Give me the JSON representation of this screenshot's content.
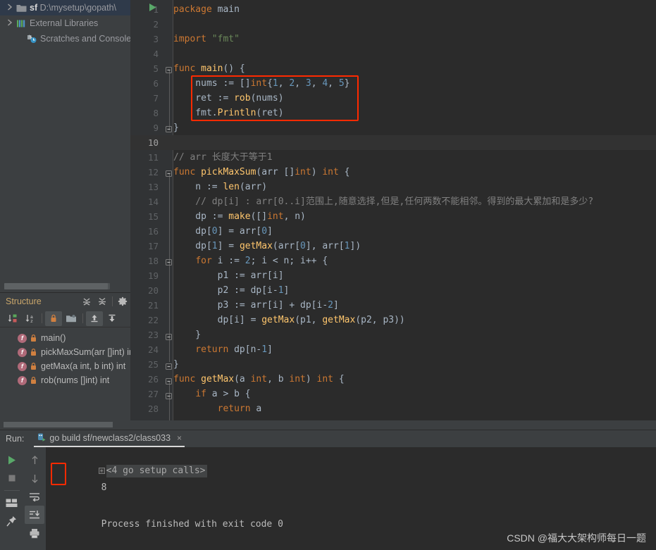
{
  "project": {
    "rows": [
      {
        "indent": 0,
        "twisty": "chevron-right-icon",
        "icon": "folder-icon",
        "name_bold": "sf",
        "name_dim": "D:\\mysetup\\gopath\\",
        "selected": true
      },
      {
        "indent": 0,
        "twisty": "chevron-right-icon",
        "icon": "library-icon",
        "name_bold": "",
        "name_dim": "External Libraries",
        "selected": false
      },
      {
        "indent": 1,
        "twisty": "",
        "icon": "scratches-icon",
        "name_bold": "",
        "name_dim": "Scratches and Consoles",
        "selected": false
      }
    ]
  },
  "structure": {
    "title": "Structure",
    "header_buttons": [
      "expand-all-icon",
      "collapse-all-icon",
      "settings-gear-icon"
    ],
    "toolbar_buttons": [
      "sort-by-visibility-icon",
      "sort-alphabetically-icon",
      "show-non-public-icon",
      "group-by-file-icon",
      "scroll-from-source-icon",
      "scroll-to-source-icon"
    ],
    "items": [
      {
        "kind": "f",
        "visibility": "lock-icon",
        "label": "main()"
      },
      {
        "kind": "f",
        "visibility": "lock-icon",
        "label": "pickMaxSum(arr []int) int"
      },
      {
        "kind": "f",
        "visibility": "lock-icon",
        "label": "getMax(a int, b int) int"
      },
      {
        "kind": "f",
        "visibility": "lock-icon",
        "label": "rob(nums []int) int"
      }
    ]
  },
  "editor": {
    "current_line": 10,
    "run_marker_line": 5,
    "lines": [
      {
        "n": 1,
        "tokens": [
          {
            "t": "kw",
            "v": "package"
          },
          {
            "t": "txt",
            "v": " main"
          }
        ]
      },
      {
        "n": 2,
        "tokens": []
      },
      {
        "n": 3,
        "tokens": [
          {
            "t": "kw",
            "v": "import"
          },
          {
            "t": "txt",
            "v": " "
          },
          {
            "t": "str",
            "v": "\"fmt\""
          }
        ]
      },
      {
        "n": 4,
        "tokens": []
      },
      {
        "n": 5,
        "tokens": [
          {
            "t": "kw",
            "v": "func"
          },
          {
            "t": "txt",
            "v": " "
          },
          {
            "t": "fn",
            "v": "main"
          },
          {
            "t": "txt",
            "v": "() {"
          }
        ]
      },
      {
        "n": 6,
        "tokens": [
          {
            "t": "txt",
            "v": "    nums := []"
          },
          {
            "t": "typ",
            "v": "int"
          },
          {
            "t": "txt",
            "v": "{"
          },
          {
            "t": "num",
            "v": "1"
          },
          {
            "t": "txt",
            "v": ", "
          },
          {
            "t": "num",
            "v": "2"
          },
          {
            "t": "txt",
            "v": ", "
          },
          {
            "t": "num",
            "v": "3"
          },
          {
            "t": "txt",
            "v": ", "
          },
          {
            "t": "num",
            "v": "4"
          },
          {
            "t": "txt",
            "v": ", "
          },
          {
            "t": "num",
            "v": "5"
          },
          {
            "t": "txt",
            "v": "}"
          }
        ]
      },
      {
        "n": 7,
        "tokens": [
          {
            "t": "txt",
            "v": "    ret := "
          },
          {
            "t": "fn",
            "v": "rob"
          },
          {
            "t": "txt",
            "v": "(nums)"
          }
        ]
      },
      {
        "n": 8,
        "tokens": [
          {
            "t": "txt",
            "v": "    fmt."
          },
          {
            "t": "fn",
            "v": "Println"
          },
          {
            "t": "txt",
            "v": "(ret)"
          }
        ]
      },
      {
        "n": 9,
        "tokens": [
          {
            "t": "txt",
            "v": "}"
          }
        ]
      },
      {
        "n": 10,
        "tokens": []
      },
      {
        "n": 11,
        "tokens": [
          {
            "t": "cmt",
            "v": "// arr 长度大于等于1"
          }
        ]
      },
      {
        "n": 12,
        "tokens": [
          {
            "t": "kw",
            "v": "func"
          },
          {
            "t": "txt",
            "v": " "
          },
          {
            "t": "fn",
            "v": "pickMaxSum"
          },
          {
            "t": "txt",
            "v": "(arr []"
          },
          {
            "t": "typ",
            "v": "int"
          },
          {
            "t": "txt",
            "v": ") "
          },
          {
            "t": "typ",
            "v": "int"
          },
          {
            "t": "txt",
            "v": " {"
          }
        ]
      },
      {
        "n": 13,
        "tokens": [
          {
            "t": "txt",
            "v": "    n := "
          },
          {
            "t": "fn",
            "v": "len"
          },
          {
            "t": "txt",
            "v": "(arr)"
          }
        ]
      },
      {
        "n": 14,
        "tokens": [
          {
            "t": "cmt",
            "v": "    // dp[i] : arr[0..i]范围上,随意选择,但是,任何两数不能相邻。得到的最大累加和是多少?"
          }
        ]
      },
      {
        "n": 15,
        "tokens": [
          {
            "t": "txt",
            "v": "    dp := "
          },
          {
            "t": "fn",
            "v": "make"
          },
          {
            "t": "txt",
            "v": "([]"
          },
          {
            "t": "typ",
            "v": "int"
          },
          {
            "t": "txt",
            "v": ", n)"
          }
        ]
      },
      {
        "n": 16,
        "tokens": [
          {
            "t": "txt",
            "v": "    dp["
          },
          {
            "t": "num",
            "v": "0"
          },
          {
            "t": "txt",
            "v": "] = arr["
          },
          {
            "t": "num",
            "v": "0"
          },
          {
            "t": "txt",
            "v": "]"
          }
        ]
      },
      {
        "n": 17,
        "tokens": [
          {
            "t": "txt",
            "v": "    dp["
          },
          {
            "t": "num",
            "v": "1"
          },
          {
            "t": "txt",
            "v": "] = "
          },
          {
            "t": "fn",
            "v": "getMax"
          },
          {
            "t": "txt",
            "v": "(arr["
          },
          {
            "t": "num",
            "v": "0"
          },
          {
            "t": "txt",
            "v": "], arr["
          },
          {
            "t": "num",
            "v": "1"
          },
          {
            "t": "txt",
            "v": "])"
          }
        ]
      },
      {
        "n": 18,
        "tokens": [
          {
            "t": "txt",
            "v": "    "
          },
          {
            "t": "kw",
            "v": "for"
          },
          {
            "t": "txt",
            "v": " i := "
          },
          {
            "t": "num",
            "v": "2"
          },
          {
            "t": "txt",
            "v": "; i < n; i++ {"
          }
        ]
      },
      {
        "n": 19,
        "tokens": [
          {
            "t": "txt",
            "v": "        p1 := arr[i]"
          }
        ]
      },
      {
        "n": 20,
        "tokens": [
          {
            "t": "txt",
            "v": "        p2 := dp[i-"
          },
          {
            "t": "num",
            "v": "1"
          },
          {
            "t": "txt",
            "v": "]"
          }
        ]
      },
      {
        "n": 21,
        "tokens": [
          {
            "t": "txt",
            "v": "        p3 := arr[i] + dp[i-"
          },
          {
            "t": "num",
            "v": "2"
          },
          {
            "t": "txt",
            "v": "]"
          }
        ]
      },
      {
        "n": 22,
        "tokens": [
          {
            "t": "txt",
            "v": "        dp[i] = "
          },
          {
            "t": "fn",
            "v": "getMax"
          },
          {
            "t": "txt",
            "v": "(p1, "
          },
          {
            "t": "fn",
            "v": "getMax"
          },
          {
            "t": "txt",
            "v": "(p2, p3))"
          }
        ]
      },
      {
        "n": 23,
        "tokens": [
          {
            "t": "txt",
            "v": "    }"
          }
        ]
      },
      {
        "n": 24,
        "tokens": [
          {
            "t": "kw",
            "v": "    return"
          },
          {
            "t": "txt",
            "v": " dp[n-"
          },
          {
            "t": "num",
            "v": "1"
          },
          {
            "t": "txt",
            "v": "]"
          }
        ]
      },
      {
        "n": 25,
        "tokens": [
          {
            "t": "txt",
            "v": "}"
          }
        ]
      },
      {
        "n": 26,
        "tokens": [
          {
            "t": "kw",
            "v": "func"
          },
          {
            "t": "txt",
            "v": " "
          },
          {
            "t": "fn",
            "v": "getMax"
          },
          {
            "t": "txt",
            "v": "(a "
          },
          {
            "t": "typ",
            "v": "int"
          },
          {
            "t": "txt",
            "v": ", b "
          },
          {
            "t": "typ",
            "v": "int"
          },
          {
            "t": "txt",
            "v": ") "
          },
          {
            "t": "typ",
            "v": "int"
          },
          {
            "t": "txt",
            "v": " {"
          }
        ]
      },
      {
        "n": 27,
        "tokens": [
          {
            "t": "txt",
            "v": "    "
          },
          {
            "t": "kw",
            "v": "if"
          },
          {
            "t": "txt",
            "v": " a > b {"
          }
        ]
      },
      {
        "n": 28,
        "tokens": [
          {
            "t": "kw",
            "v": "        return"
          },
          {
            "t": "txt",
            "v": " a"
          }
        ]
      }
    ]
  },
  "run": {
    "label": "Run:",
    "tab_title": "go build sf/newclass2/class033",
    "tab_close": "×",
    "side_buttons": [
      "rerun-icon",
      "stop-icon",
      "layout-icon",
      "pin-icon"
    ],
    "side_buttons2": [
      "up-arrow-icon",
      "down-arrow-icon",
      "soft-wrap-icon",
      "scroll-to-end-icon",
      "print-icon"
    ],
    "console": {
      "setup_calls": "<4 go setup calls>",
      "output_value": "8",
      "exit_message": "Process finished with exit code 0"
    }
  },
  "watermark": "CSDN @福大大架构师每日一题",
  "colors": {
    "highlight_box": "#ff2a00",
    "accent_title": "#c9a66b",
    "selection": "#2f3a4a",
    "editor_bg": "#2b2b2b",
    "panel_bg": "#3c3f41"
  }
}
